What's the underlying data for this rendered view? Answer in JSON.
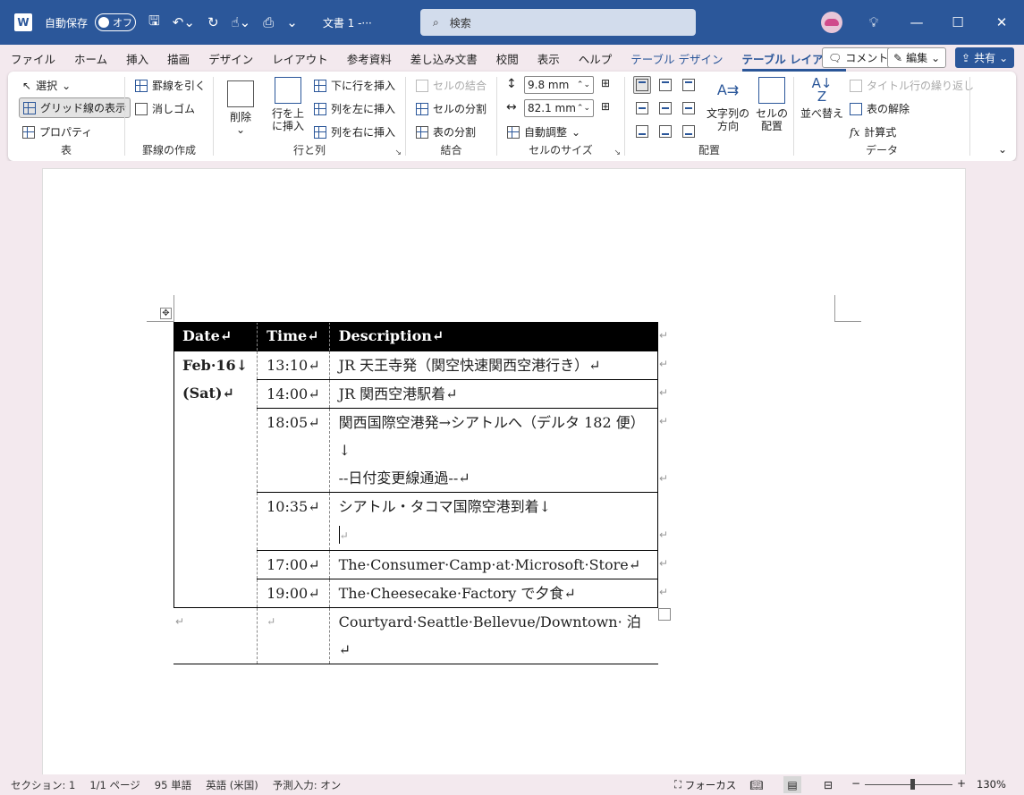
{
  "titlebar": {
    "app_icon": "W",
    "autosave_label": "自動保存",
    "autosave_state": "オフ",
    "doc_title": "文書 1  -···",
    "search_placeholder": "検索"
  },
  "tabs": [
    "ファイル",
    "ホーム",
    "挿入",
    "描画",
    "デザイン",
    "レイアウト",
    "参考資料",
    "差し込み文書",
    "校閲",
    "表示",
    "ヘルプ"
  ],
  "contextual_tabs": {
    "design": "テーブル デザイン",
    "layout": "テーブル レイアウト"
  },
  "tab_buttons": {
    "comment": "コメント",
    "edit": "編集",
    "share": "共有"
  },
  "ribbon": {
    "table": {
      "select": "選択",
      "gridlines": "グリッド線の表示",
      "properties": "プロパティ",
      "label": "表"
    },
    "draw": {
      "draw_borders": "罫線を引く",
      "eraser": "消しゴム",
      "label": "罫線の作成"
    },
    "rows_cols": {
      "delete_1": "削除",
      "insert_above_1": "行を上",
      "insert_above_2": "に挿入",
      "insert_below": "下に行を挿入",
      "insert_left": "列を左に挿入",
      "insert_right": "列を右に挿入",
      "label": "行と列"
    },
    "merge": {
      "merge_cells": "セルの結合",
      "split_cells": "セルの分割",
      "split_table": "表の分割",
      "label": "結合"
    },
    "cell_size": {
      "height": "9.8 mm",
      "width": "82.1 mm",
      "autofit": "自動調整",
      "label": "セルのサイズ"
    },
    "alignment": {
      "text_direction_1": "文字列の",
      "text_direction_2": "方向",
      "cell_margins_1": "セルの",
      "cell_margins_2": "配置",
      "label": "配置"
    },
    "data": {
      "sort": "並べ替え",
      "repeat_header": "タイトル行の繰り返し",
      "convert": "表の解除",
      "formula": "計算式",
      "label": "データ"
    }
  },
  "table": {
    "headers": [
      "Date↵",
      "Time↵",
      "Description↵"
    ],
    "date_line1": "Feb·16↓",
    "date_line2": "(Sat)↵",
    "rows": [
      {
        "time": "13:10↵",
        "desc": "JR 天王寺発（関空快速関西空港行き）↵"
      },
      {
        "time": "14:00↵",
        "desc": "JR 関西空港駅着↵"
      },
      {
        "time": "18:05↵",
        "desc": "関西国際空港発→シアトルへ（デルタ 182 便）↓",
        "desc2": "--日付変更線通過--↵"
      },
      {
        "time": "10:35↵",
        "desc": "シアトル・タコマ国際空港到着↓",
        "desc2": "↵"
      },
      {
        "time": "17:00↵",
        "desc": "The·Consumer·Camp·at·Microsoft·Store↵"
      },
      {
        "time": "19:00↵",
        "desc": "The·Cheesecake·Factory で夕食↵"
      },
      {
        "time": "↵",
        "desc": "Courtyard·Seattle·Bellevue/Downtown· 泊↵"
      }
    ],
    "end_marks": [
      "↵",
      "↵",
      "↵",
      "↵",
      "↵",
      "↵",
      "↵",
      "↵"
    ],
    "after_mark": "↵"
  },
  "status": {
    "section": "セクション: 1",
    "page": "1/1 ページ",
    "words": "95 単語",
    "language": "英語 (米国)",
    "predict": "予測入力: オン",
    "focus": "フォーカス",
    "zoom": "130%"
  }
}
